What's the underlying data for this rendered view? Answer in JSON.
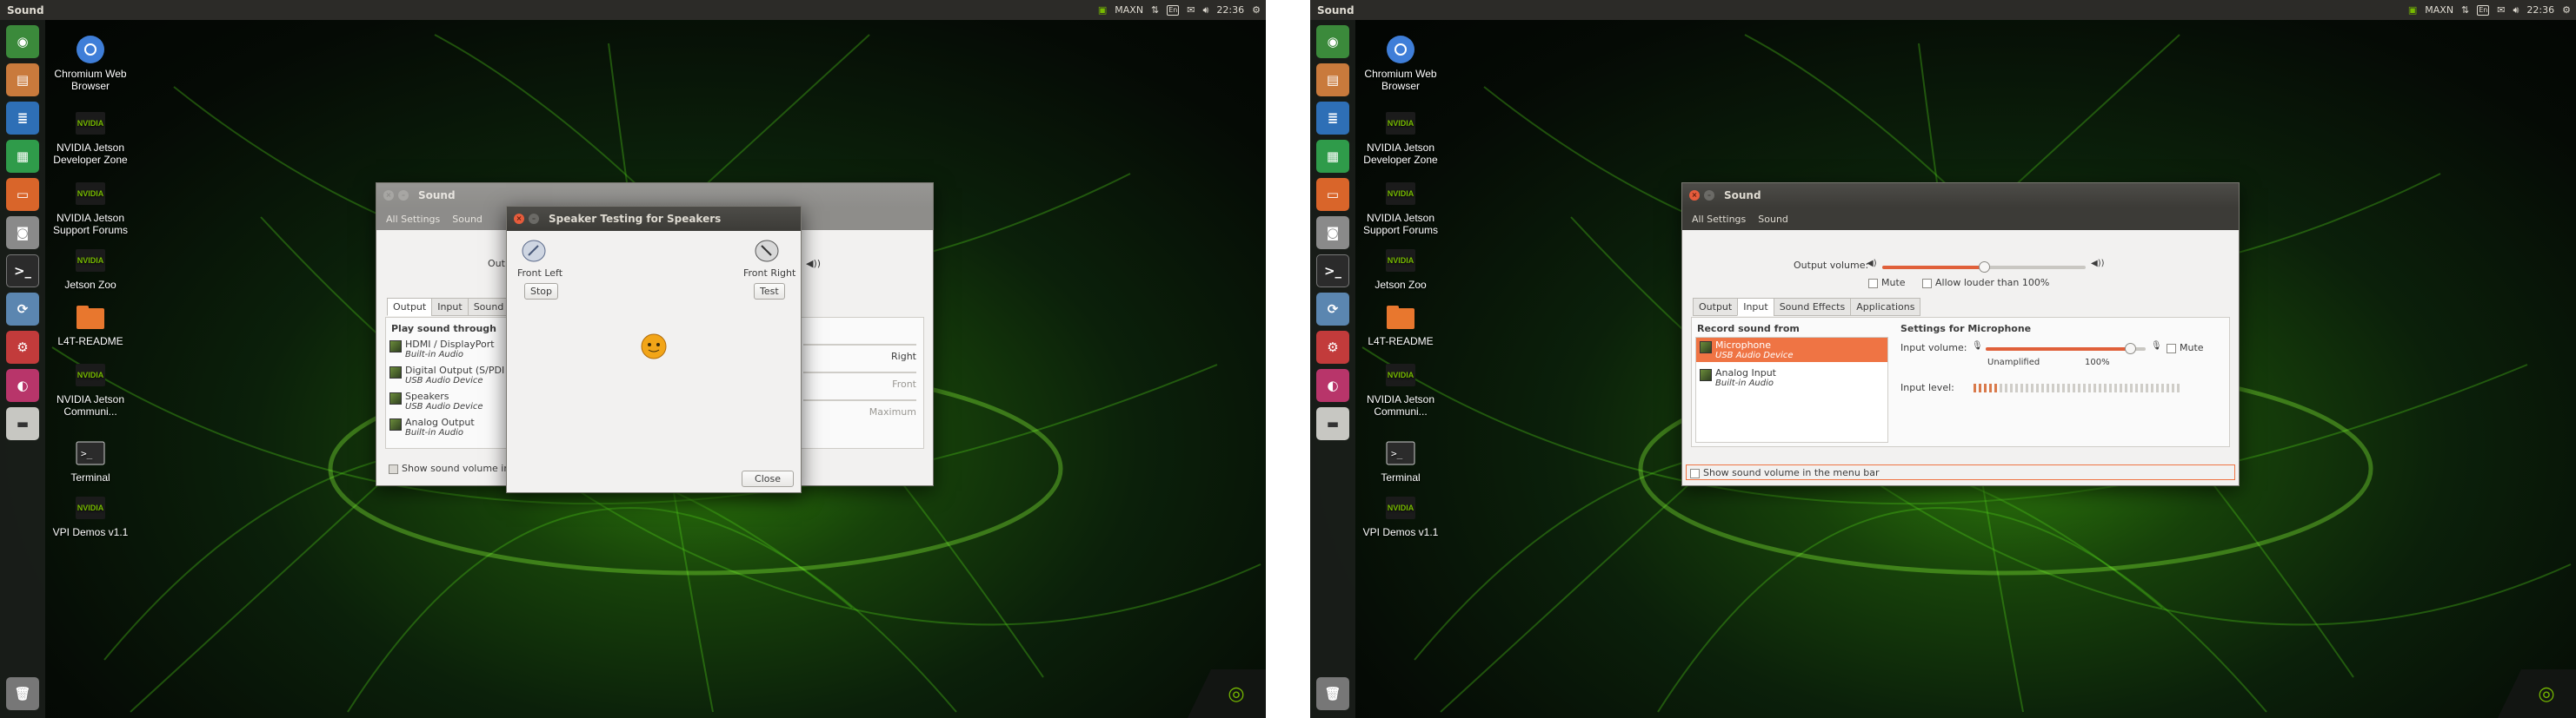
{
  "left": {
    "topbar": {
      "app": "Sound",
      "network": "MAXN",
      "keyboard": "En",
      "clock": "22:36"
    },
    "desktop": [
      {
        "label": "Chromium Web Browser",
        "icon": "chromium-icon"
      },
      {
        "label": "NVIDIA Jetson Developer Zone",
        "icon": "nvidia-icon"
      },
      {
        "label": "NVIDIA Jetson Support Forums",
        "icon": "nvidia-icon"
      },
      {
        "label": "Jetson Zoo",
        "icon": "nvidia-icon"
      },
      {
        "label": "L4T-README",
        "icon": "folder-icon"
      },
      {
        "label": "NVIDIA Jetson Communi...",
        "icon": "nvidia-icon"
      },
      {
        "label": "Terminal",
        "icon": "terminal-icon"
      },
      {
        "label": "VPI Demos v1.1",
        "icon": "nvidia-icon"
      }
    ],
    "sound_window": {
      "title": "Sound",
      "crumbs": [
        "All Settings",
        "Sound"
      ],
      "output_prefix": "Outp",
      "tabs": [
        "Output",
        "Input",
        "Sound Eff"
      ],
      "play_through": "Play sound through",
      "devices": [
        {
          "name": "HDMI / DisplayPort",
          "sub": "Built-in Audio"
        },
        {
          "name": "Digital Output (S/PDI",
          "sub": "USB Audio Device"
        },
        {
          "name": "Speakers",
          "sub": "USB Audio Device"
        },
        {
          "name": "Analog Output",
          "sub": "Built-in Audio"
        }
      ],
      "balance_labels": [
        "Right",
        "Front",
        "Maximum"
      ],
      "show_volume": "Show sound volume in th"
    },
    "speaker_test": {
      "title": "Speaker Testing for Speakers",
      "front_left": "Front Left",
      "front_right": "Front Right",
      "stop": "Stop",
      "test": "Test",
      "close": "Close"
    }
  },
  "right": {
    "topbar": {
      "app": "Sound",
      "network": "MAXN",
      "keyboard": "En",
      "clock": "22:36"
    },
    "sound_window": {
      "title": "Sound",
      "crumbs": [
        "All Settings",
        "Sound"
      ],
      "output_volume_label": "Output volume:",
      "output_volume_fraction": 0.5,
      "mute": "Mute",
      "allow_louder": "Allow louder than 100%",
      "tabs": [
        "Output",
        "Input",
        "Sound Effects",
        "Applications"
      ],
      "record_from": "Record sound from",
      "devices": [
        {
          "name": "Microphone",
          "sub": "USB Audio Device"
        },
        {
          "name": "Analog Input",
          "sub": "Built-in Audio"
        }
      ],
      "settings_for": "Settings for Microphone",
      "input_volume_label": "Input volume:",
      "input_volume_fraction": 0.9,
      "unamplified": "Unamplified",
      "hundred": "100%",
      "input_mute": "Mute",
      "input_level_label": "Input level:",
      "input_level_fraction": 0.12,
      "show_volume": "Show sound volume in the menu bar"
    }
  },
  "colors": {
    "accent": "#ef7444",
    "nvidia_green": "#76b900",
    "titlebar": "#3c3b37"
  }
}
